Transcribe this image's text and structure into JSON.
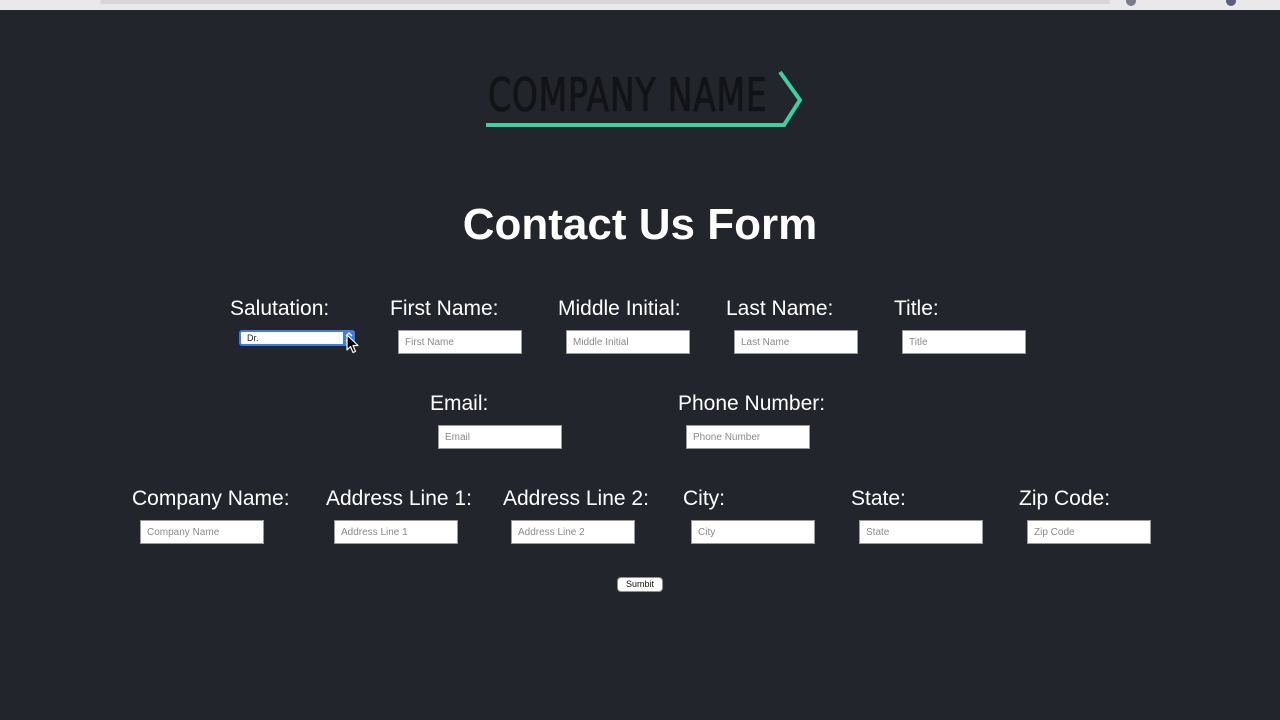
{
  "logo": {
    "text": "COMPANY NAME",
    "accent_color": "#3ecf9f"
  },
  "page_title": "Contact Us Form",
  "colors": {
    "background": "#22252b",
    "select_accent": "#3b7ce9"
  },
  "row1": {
    "salutation": {
      "label": "Salutation:",
      "selected": "Dr."
    },
    "first_name": {
      "label": "First Name:",
      "placeholder": "First Name"
    },
    "middle_initial": {
      "label": "Middle Initial:",
      "placeholder": "Middle Initial"
    },
    "last_name": {
      "label": "Last Name:",
      "placeholder": "Last Name"
    },
    "title": {
      "label": "Title:",
      "placeholder": "Title"
    }
  },
  "row2": {
    "email": {
      "label": "Email:",
      "placeholder": "Email"
    },
    "phone": {
      "label": "Phone Number:",
      "placeholder": "Phone Number"
    }
  },
  "row3": {
    "company_name": {
      "label": "Company Name:",
      "placeholder": "Company Name"
    },
    "address_line_1": {
      "label": "Address Line 1:",
      "placeholder": "Address Line 1"
    },
    "address_line_2": {
      "label": "Address Line 2:",
      "placeholder": "Address Line 2"
    },
    "city": {
      "label": "City:",
      "placeholder": "City"
    },
    "state": {
      "label": "State:",
      "placeholder": "State"
    },
    "zip_code": {
      "label": "Zip Code:",
      "placeholder": "Zip Code"
    }
  },
  "submit_label": "Sumbit",
  "icons": {
    "select_arrows": "chevron-up-down-icon",
    "pointer": "mouse-cursor-icon"
  }
}
